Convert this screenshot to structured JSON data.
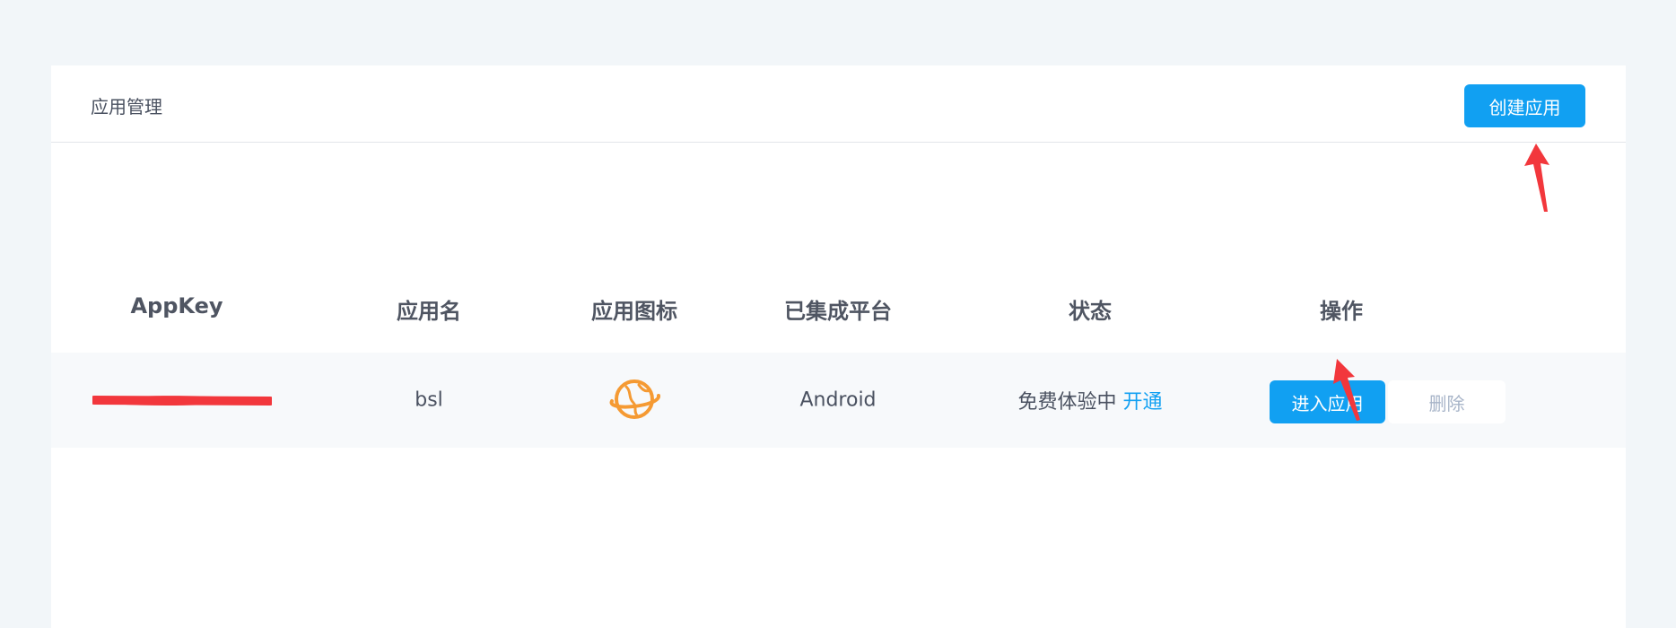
{
  "header": {
    "title": "应用管理",
    "create_button_label": "创建应用"
  },
  "table": {
    "columns": [
      "AppKey",
      "应用名",
      "应用图标",
      "已集成平台",
      "状态",
      "操作"
    ],
    "rows": [
      {
        "app_key": "",
        "app_name": "bsl",
        "app_icon": "planet-icon",
        "platform": "Android",
        "status_text": "免费体验中",
        "status_link": "开通",
        "actions": {
          "enter_label": "进入应用",
          "delete_label": "删除"
        }
      }
    ]
  },
  "colors": {
    "primary": "#11a0f2",
    "icon_orange": "#f59a33",
    "annotation_red": "#f2373c"
  }
}
